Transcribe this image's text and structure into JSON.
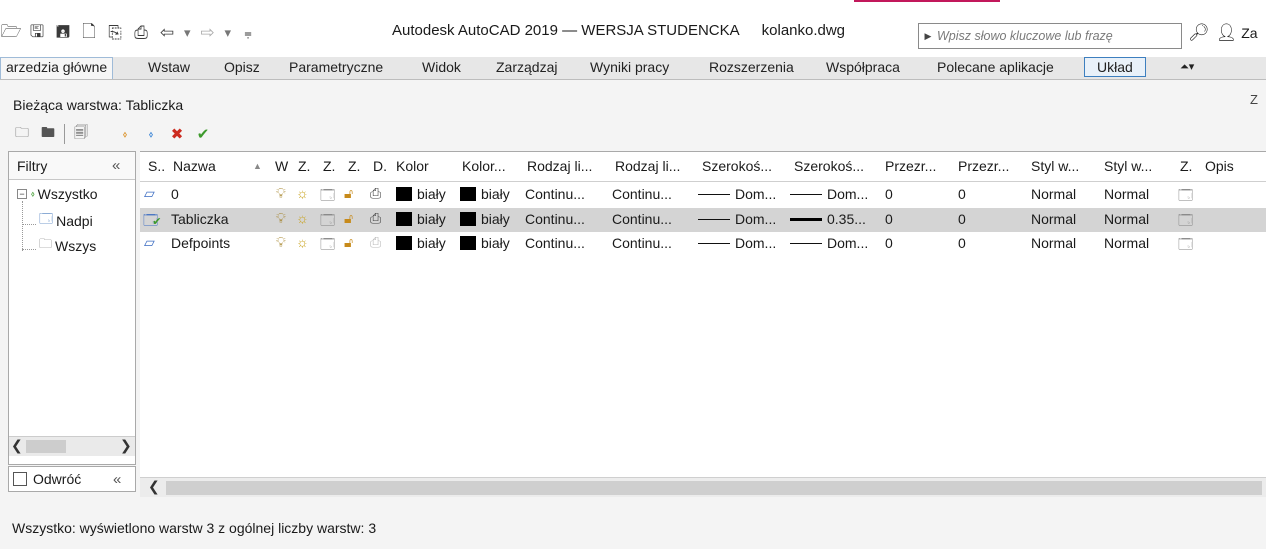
{
  "window": {
    "app_title": "Autodesk AutoCAD 2019 — WERSJA STUDENCKA",
    "file_name": "kolanko.dwg",
    "search_placeholder": "Wpisz słowo kluczowe lub frazę",
    "corner_text": "Za"
  },
  "quick_access": {
    "icons": [
      "open-icon",
      "save-icon",
      "save-as-icon",
      "publish-icon",
      "import-icon",
      "plot-icon",
      "undo-icon",
      "redo-icon",
      "customize-icon"
    ]
  },
  "ribbon": {
    "tabs": [
      {
        "label": "arzedzia główne",
        "state": "active"
      },
      {
        "label": "Wstaw"
      },
      {
        "label": "Opisz"
      },
      {
        "label": "Parametryczne"
      },
      {
        "label": "Widok"
      },
      {
        "label": "Zarządzaj"
      },
      {
        "label": "Wyniki pracy"
      },
      {
        "label": "Rozszerzenia"
      },
      {
        "label": "Współpraca"
      },
      {
        "label": "Polecane aplikacje"
      },
      {
        "label": "Układ",
        "state": "contextual"
      }
    ]
  },
  "panel": {
    "current_layer": "Bieżąca warstwa: Tabliczka",
    "corner_label": "Z"
  },
  "filters": {
    "header": "Filtry",
    "collapse_glyph": "«",
    "tree": [
      {
        "label": "Wszystko",
        "level": 0
      },
      {
        "label": "Nadpi",
        "level": 1
      },
      {
        "label": "Wszys",
        "level": 1
      }
    ],
    "invert_label": "Odwróć"
  },
  "grid": {
    "columns": [
      "S..",
      "Nazwa",
      "W",
      "Z.",
      "Z.",
      "Z.",
      "D.",
      "Kolor",
      "Kolor...",
      "Rodzaj li...",
      "Rodzaj li...",
      "Szerokoś...",
      "Szerokoś...",
      "Przezr...",
      "Przezr...",
      "Styl w...",
      "Styl w...",
      "Z.",
      "Opis"
    ],
    "rows": [
      {
        "name": "0",
        "status": "layer",
        "plot_on": true,
        "color": "biały",
        "color2": "biały",
        "linetype": "Continu...",
        "linetype2": "Continu...",
        "lw": "Dom...",
        "lw2": "Dom...",
        "lw2_thick": false,
        "transp": "0",
        "transp2": "0",
        "plotstyle": "Normal",
        "plotstyle2": "Normal",
        "selected": false
      },
      {
        "name": "Tabliczka",
        "status": "current",
        "plot_on": true,
        "color": "biały",
        "color2": "biały",
        "linetype": "Continu...",
        "linetype2": "Continu...",
        "lw": "Dom...",
        "lw2": "0.35...",
        "lw2_thick": true,
        "transp": "0",
        "transp2": "0",
        "plotstyle": "Normal",
        "plotstyle2": "Normal",
        "selected": true
      },
      {
        "name": "Defpoints",
        "status": "layer",
        "plot_on": false,
        "color": "biały",
        "color2": "biały",
        "linetype": "Continu...",
        "linetype2": "Continu...",
        "lw": "Dom...",
        "lw2": "Dom...",
        "lw2_thick": false,
        "transp": "0",
        "transp2": "0",
        "plotstyle": "Normal",
        "plotstyle2": "Normal",
        "selected": false
      }
    ]
  },
  "status_bar": {
    "text": "Wszystko: wyświetlono warstw 3 z ogólnej liczby warstw: 3"
  },
  "colors": {
    "accent": "#c2185b",
    "selected_row": "#d4d4d4",
    "contextual_tab_border": "#3d7fbf"
  }
}
